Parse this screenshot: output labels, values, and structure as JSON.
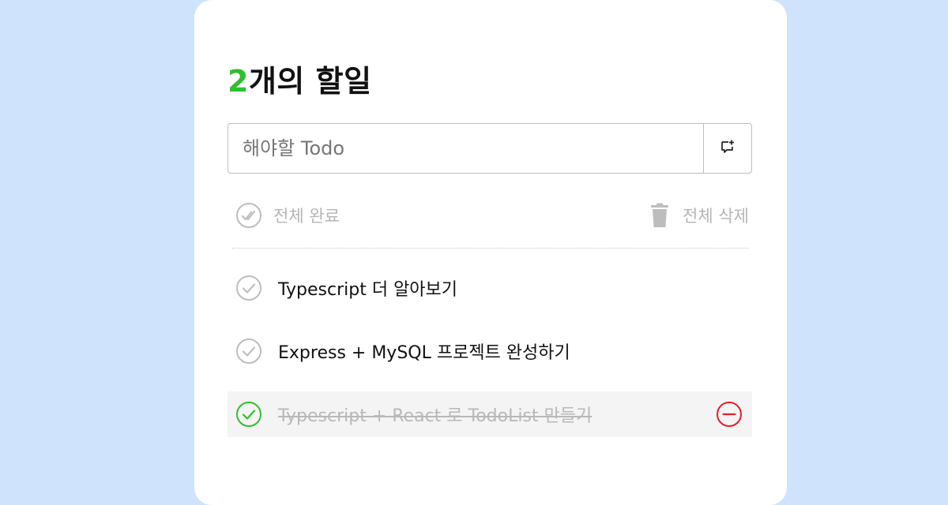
{
  "header": {
    "count": "2",
    "title_suffix": "개의 할일"
  },
  "input": {
    "placeholder": "해야할 Todo",
    "value": ""
  },
  "add_button_icon": "add-comment-icon",
  "toolbar": {
    "complete_all_label": "전체 완료",
    "delete_all_label": "전체 삭제"
  },
  "todos": [
    {
      "text": "Typescript 더 알아보기",
      "done": false
    },
    {
      "text": "Express + MySQL 프로젝트 완성하기",
      "done": false
    },
    {
      "text": "Typescript + React 로 TodoList 만들기",
      "done": true
    }
  ],
  "colors": {
    "background": "#cfe3fd",
    "accent_green": "#2fbf2f",
    "danger_red": "#e0202a",
    "muted_gray": "#b5b5b5"
  }
}
